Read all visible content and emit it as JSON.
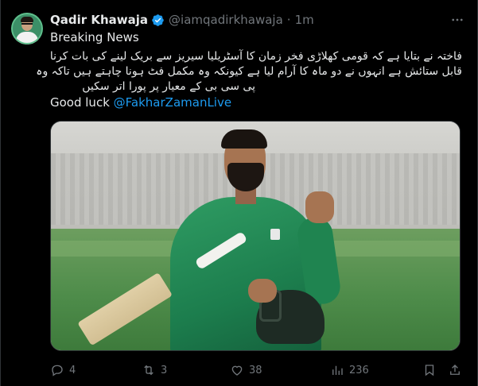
{
  "author": {
    "name": "Qadir Khawaja",
    "handle": "@iamqadirkhawaja",
    "separator": "·",
    "time": "1m"
  },
  "tweet": {
    "line1": "Breaking News",
    "urdu1": "فاختہ نے بتایا ہے کہ قومی کھلاڑی فخر زمان کا آسٹریلیا سیریز سے بریک لینے کی بات کرنا",
    "urdu2": "قابل ستائش ہے انہوں نے دو ماہ کا آرام لیا ہے کیونکہ وہ مکمل فٹ ہونا چاہتے ہیں تاکہ وہ",
    "urdu3": "پی سی بی کے معیار پر پورا اتر سکیں",
    "goodluck": "Good luck",
    "mention": "@FakharZamanLive"
  },
  "actions": {
    "reply_count": "4",
    "retweet_count": "3",
    "like_count": "38",
    "views_count": "236"
  },
  "colors": {
    "accent": "#1d9bf0",
    "muted": "#71767b",
    "text": "#e7e9ea",
    "background": "#000000"
  },
  "icons": [
    "verified-icon",
    "more-icon",
    "reply-icon",
    "retweet-icon",
    "like-icon",
    "views-icon",
    "bookmark-icon",
    "share-icon"
  ]
}
